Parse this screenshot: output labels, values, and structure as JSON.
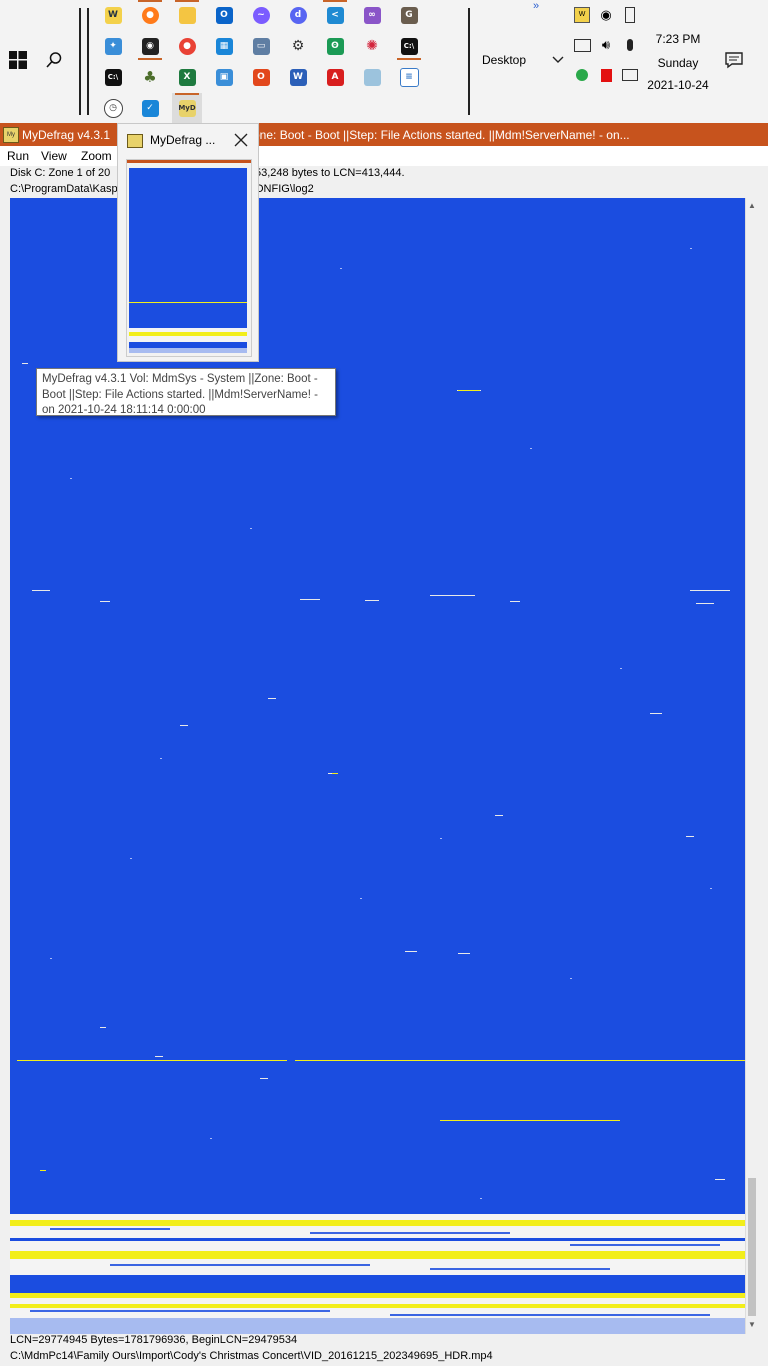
{
  "taskbar": {
    "desktop_label": "Desktop",
    "overflow_glyph": "»",
    "clock": {
      "time": "7:23 PM",
      "day": "Sunday",
      "date": "2021-10-24"
    },
    "pinned_icons": [
      "notepad-calc-icon",
      "firefox-icon",
      "file-explorer-icon",
      "outlook-icon",
      "messenger-icon",
      "discord-icon",
      "vscode-icon",
      "visual-studio-icon",
      "gimp-icon",
      "control-panel-icon",
      "camera-app-icon",
      "chrome-icon",
      "windows-store-icon",
      "remote-desktop-icon",
      "settings-icon",
      "green-app-icon",
      "red-star-app-icon",
      "terminal-icon",
      "cmd-icon",
      "tree-app-icon",
      "excel-icon",
      "image-viewer-icon",
      "office-icon",
      "word-icon",
      "acrobat-icon",
      "notebook-icon",
      "document-icon",
      "clock-app-icon",
      "checkmark-app-icon",
      "mydefrag-icon"
    ],
    "tray_icons": [
      "wc-tray-icon",
      "camera-tray-icon",
      "usb-tray-icon",
      "display-tray-icon",
      "volume-icon",
      "microphone-icon",
      "green-tray-icon",
      "red-tray-icon",
      "network-icon"
    ]
  },
  "window": {
    "title_left": "MyDefrag v4.3.1",
    "title_right": "one: Boot - Boot ||Step: File Actions started. ||Mdm!ServerName! -  on...",
    "menu": [
      "Run",
      "View",
      "Zoom"
    ],
    "status_line1_left": "Disk C:   Zone 1 of 20",
    "status_line1_right": "53,248 bytes to LCN=413,444.",
    "status_line2_left": "C:\\ProgramData\\Kasp",
    "status_line2_right": "ONFIG\\log2",
    "bottom_line1": "LCN=29774945     Bytes=1781796936, BeginLCN=29479534",
    "bottom_line2": "C:\\MdmPc14\\Family Ours\\Import\\Cody's Christmas Concert\\VID_20161215_202349695_HDR.mp4"
  },
  "thumbnail": {
    "title": "MyDefrag ...",
    "tooltip": "MyDefrag v4.3.1    Vol: MdmSys - System ||Zone: Boot - Boot ||Step: File Actions started. ||Mdm!ServerName! - on 2021-10-24 18:11:14 0:00:00"
  },
  "colors": {
    "titlebar": "#c7531d",
    "disk_free": "#1b4de0",
    "disk_used_yellow": "#f2ee1a",
    "disk_used_white": "#f4f4f4",
    "taskbar_bg": "#f3f3f3"
  }
}
